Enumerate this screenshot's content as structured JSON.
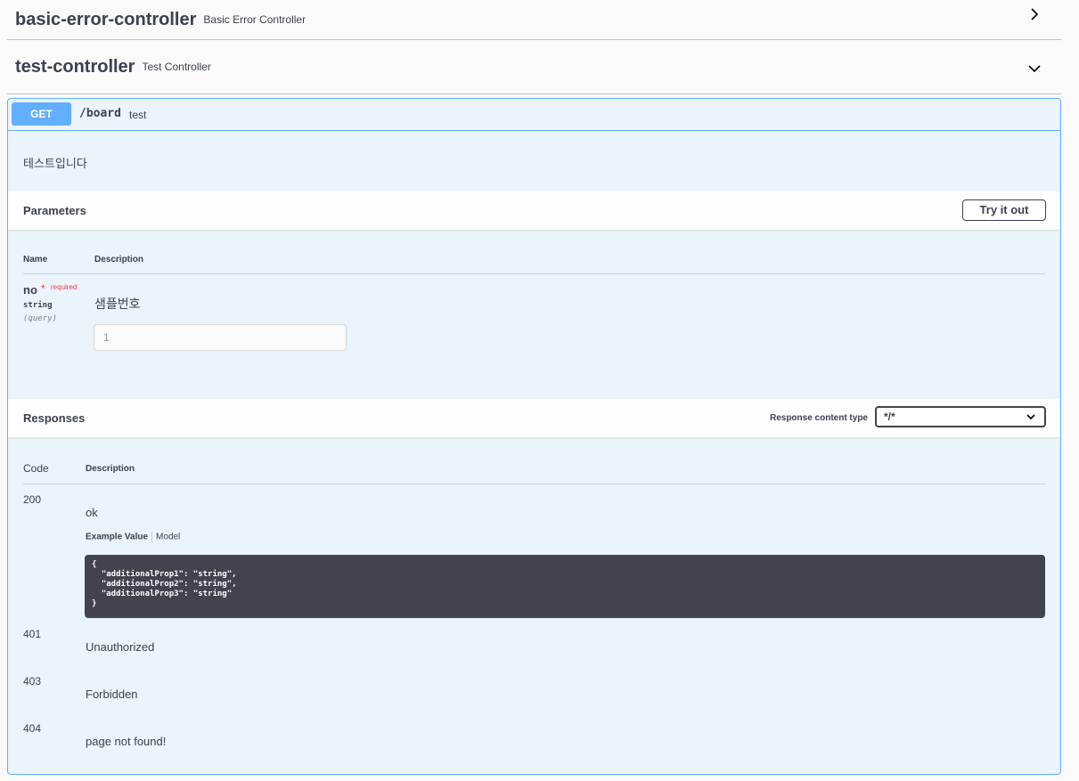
{
  "tags": [
    {
      "name": "basic-error-controller",
      "description": "Basic Error Controller",
      "state": "collapsed",
      "icon": "chevron-right-icon"
    },
    {
      "name": "test-controller",
      "description": "Test Controller",
      "state": "expanded",
      "icon": "chevron-down-icon"
    }
  ],
  "operation": {
    "method": "GET",
    "path": "/board",
    "summary": "test",
    "description": "테스트입니다",
    "colors": {
      "get": "#61affe",
      "background": "#ebf3fb",
      "required": "#f93e3e",
      "code_bg": "#41444e"
    }
  },
  "parameters": {
    "title": "Parameters",
    "try_it_out": "Try it out",
    "col_name": "Name",
    "col_description": "Description",
    "items": [
      {
        "name": "no",
        "required_mark": "*",
        "required_label": "required",
        "type": "string",
        "in": "(query)",
        "description": "샘플번호",
        "placeholder": "1"
      }
    ]
  },
  "responses": {
    "title": "Responses",
    "content_type_label": "Response content type",
    "content_type_value": "*/*",
    "col_code": "Code",
    "col_description": "Description",
    "example_tab": "Example Value",
    "model_tab": "Model",
    "example_lines": [
      "{",
      "  \"additionalProp1\": \"string\",",
      "  \"additionalProp2\": \"string\",",
      "  \"additionalProp3\": \"string\"",
      "}"
    ],
    "items": [
      {
        "code": "200",
        "description": "ok"
      },
      {
        "code": "401",
        "description": "Unauthorized"
      },
      {
        "code": "403",
        "description": "Forbidden"
      },
      {
        "code": "404",
        "description": "page not found!"
      }
    ]
  }
}
